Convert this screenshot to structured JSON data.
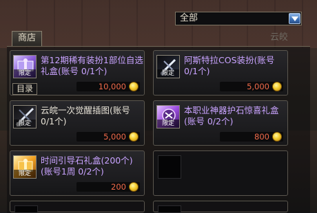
{
  "dropdown": {
    "selected": "全部"
  },
  "tab": {
    "label": "商店"
  },
  "side_label": "云皎",
  "catalog_label": "目录",
  "limit_label": "限定",
  "items": [
    {
      "title": "第12期稀有装扮1部位自选礼盒(账号 0/1个)",
      "price": "10,000",
      "color": "purple"
    },
    {
      "title": "阿斯特拉COS装扮(账号 0/1个)",
      "price": "5,000",
      "color": "purple"
    },
    {
      "title": "云皖一次觉醒插图(账号 0/1个)",
      "price": "5,000",
      "color": "purple"
    },
    {
      "title": "本职业神器护石惊喜礼盒(账号 0/2个)",
      "price": "800",
      "color": "purple"
    },
    {
      "title": "时间引导石礼盒(200个)(账号1周 0/2个)",
      "price": "200",
      "color": "purple"
    }
  ],
  "colors": {
    "title_purple": "#c9a3ff",
    "price_red": "#f06a4a",
    "coin_gold": "#f4cd2e",
    "dropdown_blue": "#3b6fb5"
  }
}
